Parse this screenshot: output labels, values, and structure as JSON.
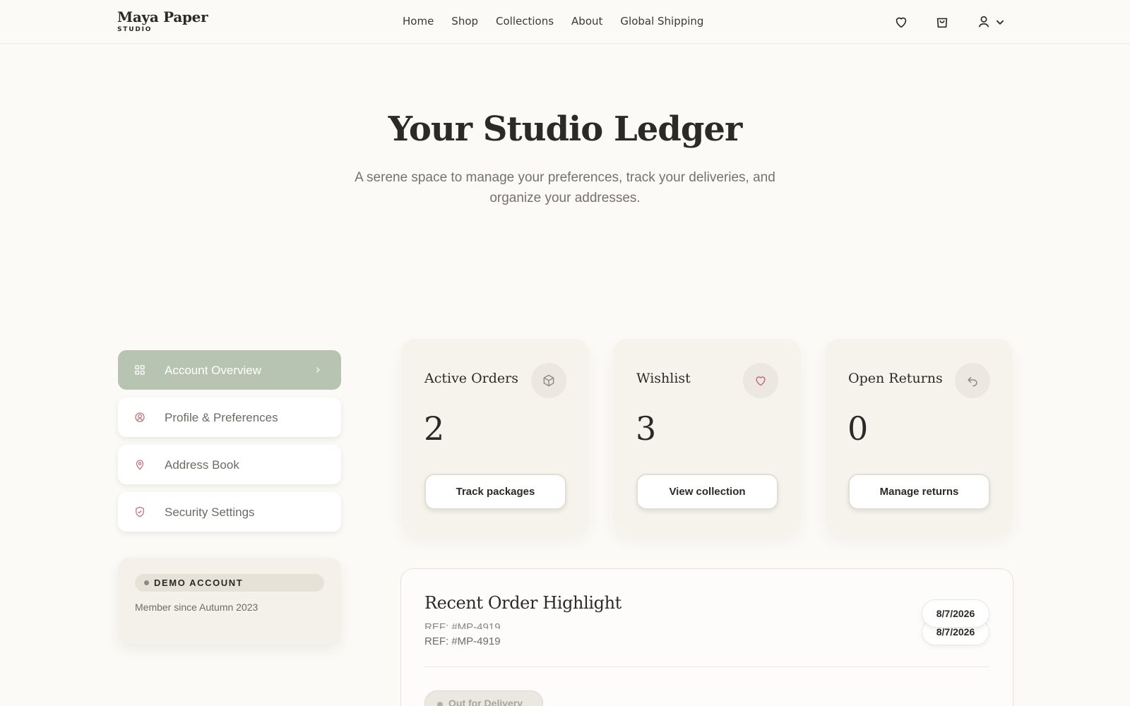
{
  "brand": {
    "name": "Maya Paper",
    "sub": "STUDIO"
  },
  "nav": {
    "items": [
      "Home",
      "Shop",
      "Collections",
      "About",
      "Global Shipping"
    ]
  },
  "header_icons": [
    "heart-icon",
    "shopping-bag-icon",
    "user-icon",
    "chevron-down-icon"
  ],
  "hero": {
    "title": "Your Studio Ledger",
    "subtitle": "A serene space to manage your preferences, track your deliveries, and organize your addresses."
  },
  "sidebar": {
    "items": [
      {
        "label": "Account Overview",
        "icon": "grid-icon",
        "active": true
      },
      {
        "label": "Profile & Preferences",
        "icon": "user-circle-icon",
        "active": false
      },
      {
        "label": "Address Book",
        "icon": "map-pin-icon",
        "active": false
      },
      {
        "label": "Security Settings",
        "icon": "shield-icon",
        "active": false
      }
    ],
    "demo": {
      "badge": "DEMO ACCOUNT",
      "member": "Member since Autumn 2023"
    }
  },
  "stats": [
    {
      "label": "Active Orders",
      "value": "2",
      "button": "Track packages",
      "icon": "package-icon"
    },
    {
      "label": "Wishlist",
      "value": "3",
      "button": "View collection",
      "icon": "heart-icon"
    },
    {
      "label": "Open Returns",
      "value": "0",
      "button": "Manage returns",
      "icon": "return-arrow-icon"
    }
  ],
  "recent_order": {
    "title": "Recent Order Highlight",
    "ref": "REF: #MP-4919",
    "date": "8/7/2026",
    "status": "Out for Delivery"
  },
  "colors": {
    "background": "#fbfaf6",
    "active_sage": "#b6c4b1",
    "accent_rose": "#c0717a",
    "text": "#2b2a27"
  }
}
